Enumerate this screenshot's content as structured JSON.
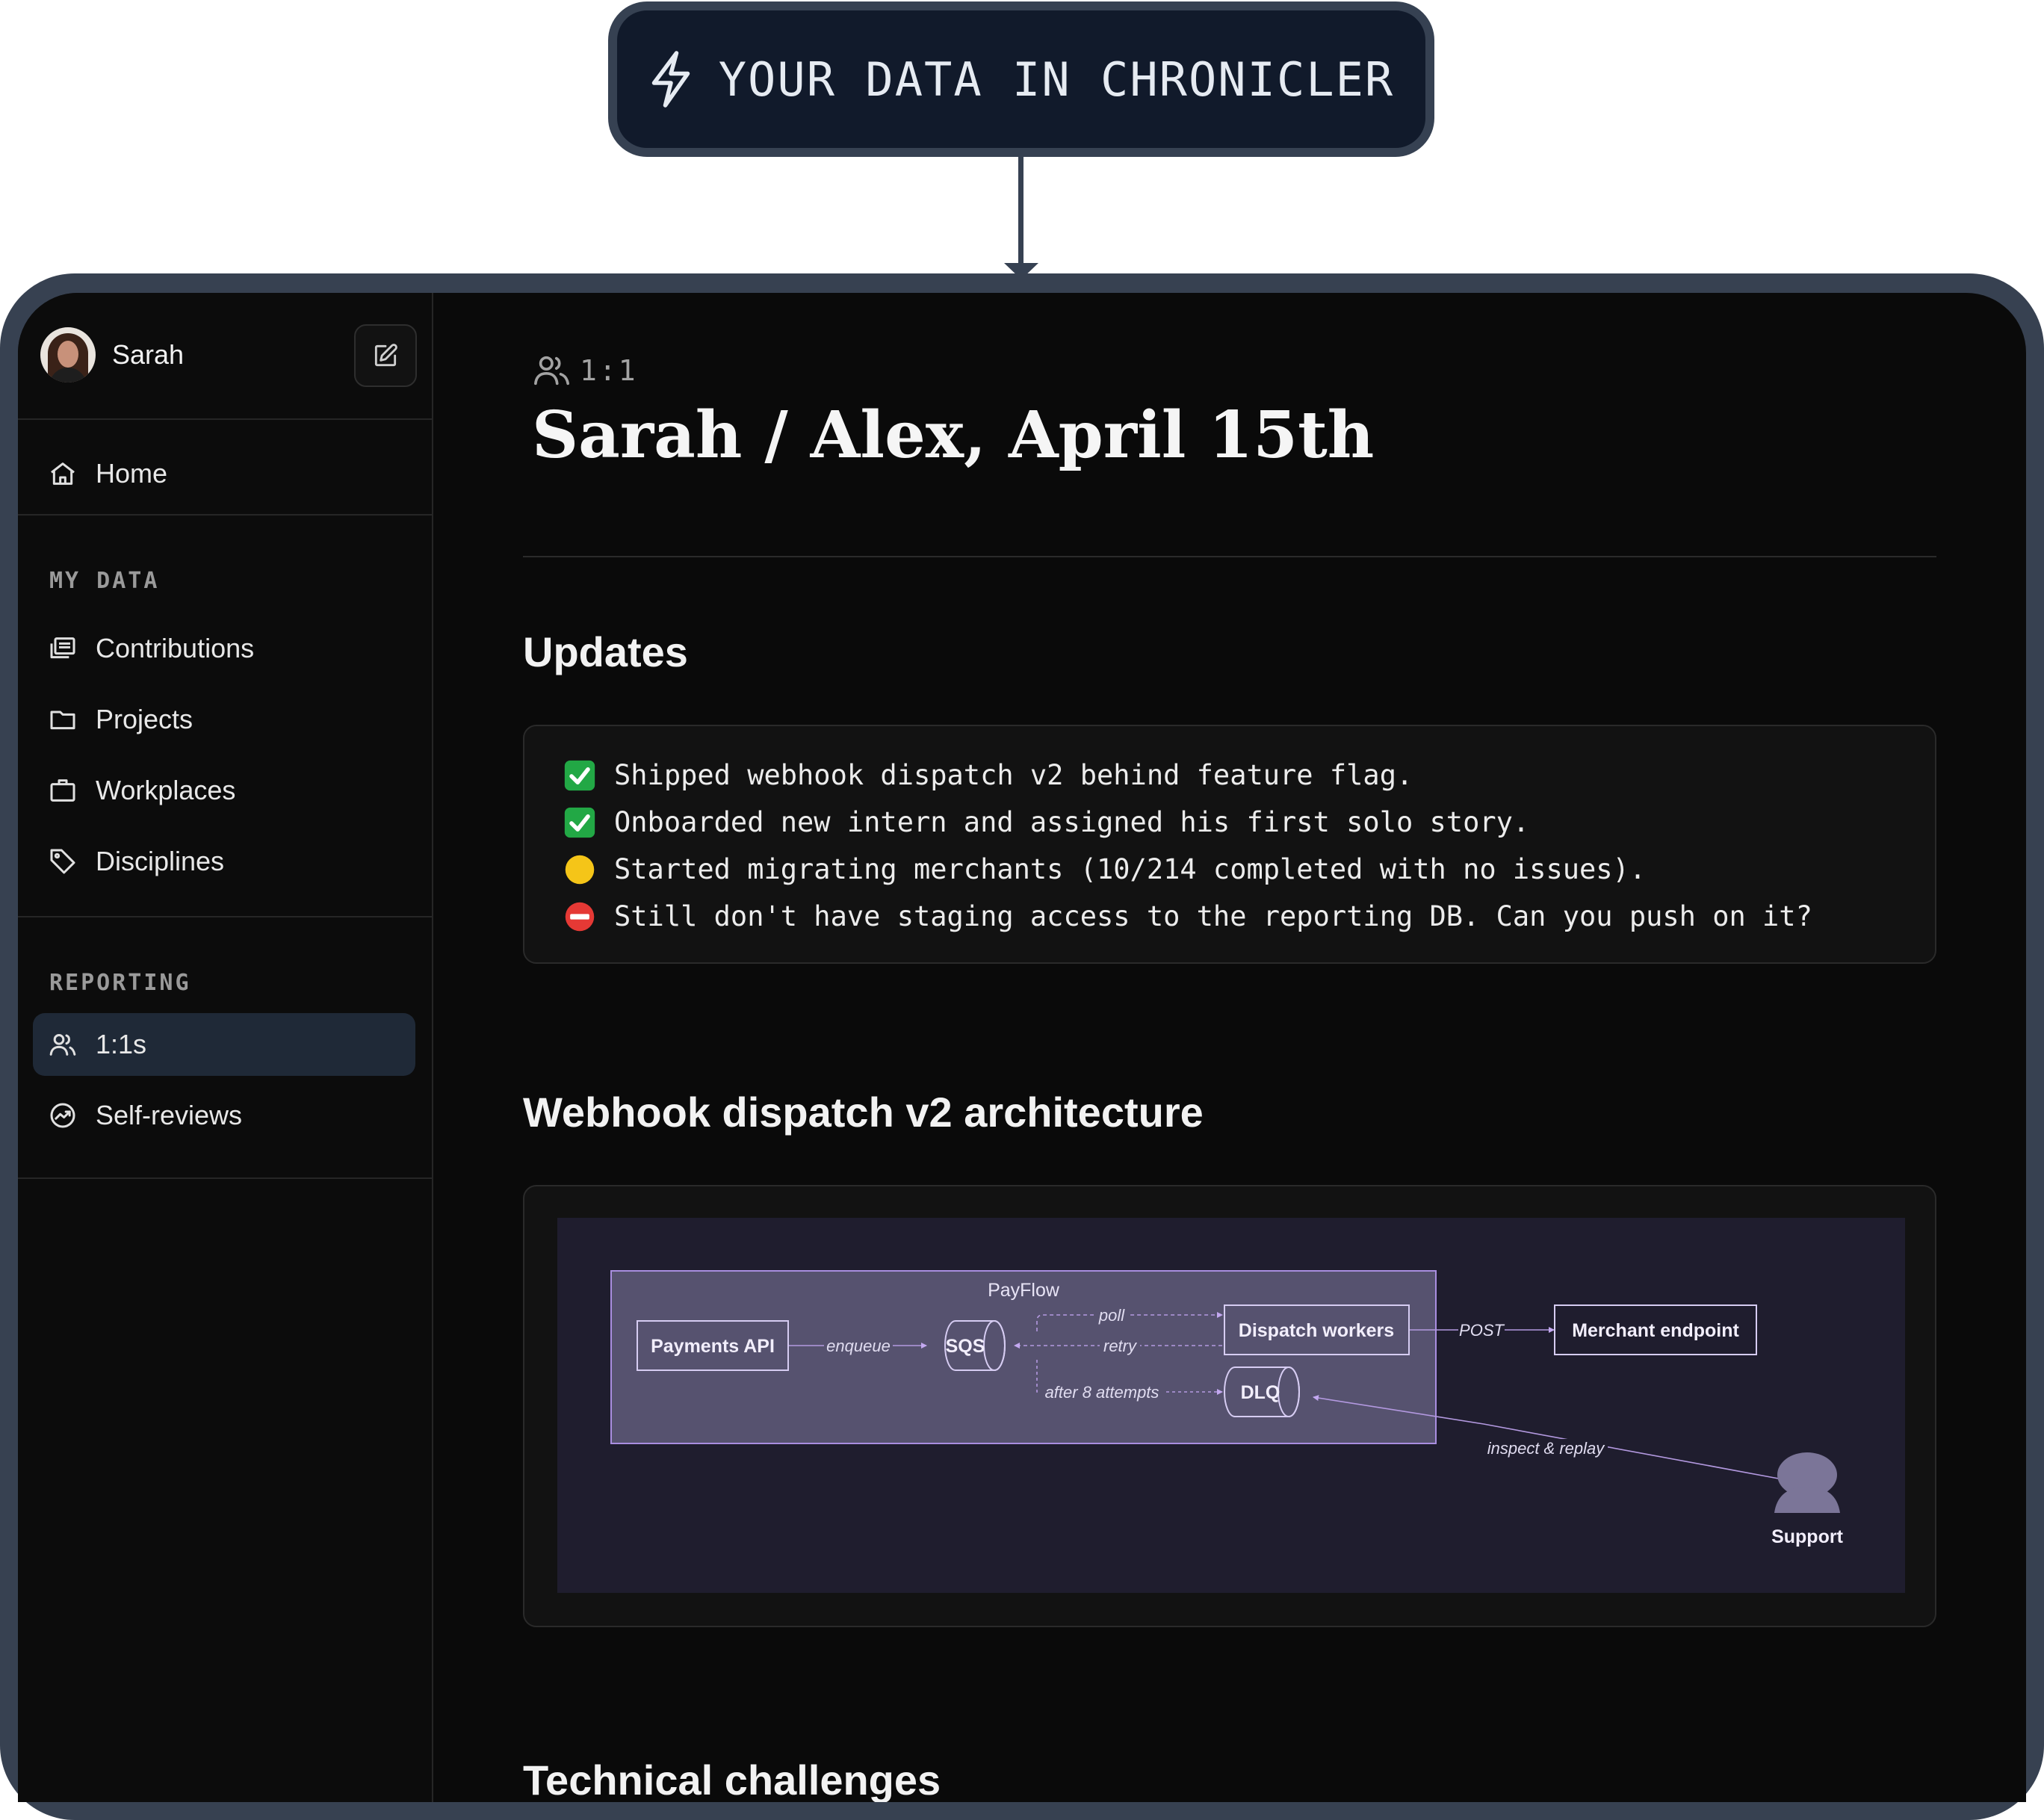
{
  "badge": {
    "label": "YOUR DATA IN CHRONICLER",
    "icon": "lightning-bolt-icon"
  },
  "sidebar": {
    "user": {
      "name": "Sarah"
    },
    "home": {
      "label": "Home",
      "icon": "home-icon"
    },
    "sections": [
      {
        "title": "MY DATA",
        "items": [
          {
            "label": "Contributions",
            "icon": "contributions-icon"
          },
          {
            "label": "Projects",
            "icon": "folder-icon"
          },
          {
            "label": "Workplaces",
            "icon": "briefcase-icon"
          },
          {
            "label": "Disciplines",
            "icon": "tag-icon"
          }
        ]
      },
      {
        "title": "REPORTING",
        "items": [
          {
            "label": "1:1s",
            "icon": "users-icon",
            "active": true
          },
          {
            "label": "Self-reviews",
            "icon": "trend-icon"
          }
        ]
      }
    ]
  },
  "main": {
    "breadcrumb": "1:1",
    "title": "Sarah / Alex, April 15th",
    "updates": {
      "heading": "Updates",
      "items": [
        {
          "status": "done",
          "text": "Shipped webhook dispatch v2 behind feature flag."
        },
        {
          "status": "done",
          "text": "Onboarded new intern and assigned his first solo story."
        },
        {
          "status": "in-progress",
          "text": "Started migrating merchants (10/214 completed with no issues)."
        },
        {
          "status": "blocked",
          "text": "Still don't have staging access to the reporting DB. Can you push on it?"
        }
      ]
    },
    "architecture": {
      "heading": "Webhook dispatch v2 architecture",
      "diagram": {
        "group": "PayFlow",
        "nodes": {
          "payments_api": "Payments API",
          "sqs": "SQS",
          "dispatch_workers": "Dispatch workers",
          "dlq": "DLQ",
          "merchant_endpoint": "Merchant endpoint",
          "support": "Support"
        },
        "edges": {
          "enqueue": "enqueue",
          "poll": "poll",
          "retry": "retry",
          "after_attempts": "after 8 attempts",
          "post": "POST",
          "inspect_replay": "inspect & replay"
        }
      }
    },
    "next_heading": "Technical challenges"
  },
  "colors": {
    "background": "#0a0a0a",
    "frame": "#374151",
    "badge_bg": "#111a2b",
    "active_nav": "#1f2937",
    "diagram_bg": "#1f1d2e",
    "diagram_group": "#56526f",
    "diagram_stroke": "#b399e0",
    "status_done": "#22a845",
    "status_in_progress": "#f5c518",
    "status_blocked": "#e53935"
  }
}
